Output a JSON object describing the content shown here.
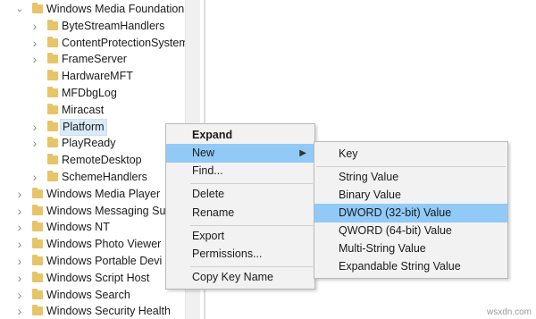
{
  "tree": {
    "items": [
      {
        "label": "Windows Media Foundation",
        "level": 0,
        "expander": "open"
      },
      {
        "label": "ByteStreamHandlers",
        "level": 1,
        "expander": "closed"
      },
      {
        "label": "ContentProtectionSystem",
        "level": 1,
        "expander": "closed"
      },
      {
        "label": "FrameServer",
        "level": 1,
        "expander": "closed"
      },
      {
        "label": "HardwareMFT",
        "level": 1,
        "expander": "none"
      },
      {
        "label": "MFDbgLog",
        "level": 1,
        "expander": "none"
      },
      {
        "label": "Miracast",
        "level": 1,
        "expander": "none"
      },
      {
        "label": "Platform",
        "level": 1,
        "expander": "closed",
        "selected": true
      },
      {
        "label": "PlayReady",
        "level": 1,
        "expander": "closed"
      },
      {
        "label": "RemoteDesktop",
        "level": 1,
        "expander": "none"
      },
      {
        "label": "SchemeHandlers",
        "level": 1,
        "expander": "closed"
      },
      {
        "label": "Windows Media Player",
        "level": 0,
        "expander": "closed"
      },
      {
        "label": "Windows Messaging Su",
        "level": 0,
        "expander": "closed"
      },
      {
        "label": "Windows NT",
        "level": 0,
        "expander": "closed"
      },
      {
        "label": "Windows Photo Viewer",
        "level": 0,
        "expander": "closed"
      },
      {
        "label": "Windows Portable Devi",
        "level": 0,
        "expander": "closed"
      },
      {
        "label": "Windows Script Host",
        "level": 0,
        "expander": "closed"
      },
      {
        "label": "Windows Search",
        "level": 0,
        "expander": "closed"
      },
      {
        "label": "Windows Security Health",
        "level": 0,
        "expander": "closed"
      }
    ]
  },
  "context_menu": {
    "expand": "Expand",
    "new": "New",
    "find": "Find...",
    "delete": "Delete",
    "rename": "Rename",
    "export": "Export",
    "permissions": "Permissions...",
    "copy_key_name": "Copy Key Name",
    "submenu_arrow": "▶"
  },
  "new_submenu": {
    "key": "Key",
    "string_value": "String Value",
    "binary_value": "Binary Value",
    "dword_value": "DWORD (32-bit) Value",
    "qword_value": "QWORD (64-bit) Value",
    "multi_string_value": "Multi-String Value",
    "expandable_string_value": "Expandable String Value"
  },
  "colors": {
    "folder": "#e8c468",
    "menu_highlight": "#91c9f7",
    "menu_background": "#f2f2f2",
    "tree_selection": "#dbeaf8"
  },
  "watermark": "wsxdn.com"
}
